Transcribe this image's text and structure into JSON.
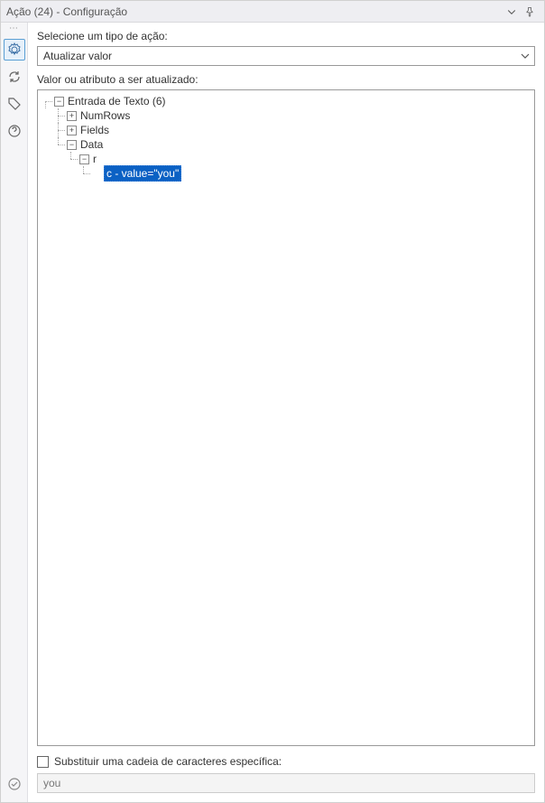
{
  "titlebar": {
    "title": "Ação (24) - Configuração"
  },
  "labels": {
    "actionType": "Selecione um tipo de ação:",
    "valueToUpdate": "Valor ou atributo a ser atualizado:",
    "replaceSpecific": "Substituir uma cadeia de caracteres específica:"
  },
  "select": {
    "value": "Atualizar valor"
  },
  "tree": {
    "root": "Entrada de Texto (6)",
    "numRows": "NumRows",
    "fields": "Fields",
    "data": "Data",
    "r": "r",
    "selected": "c - value=\"you\""
  },
  "replaceInput": {
    "value": "you"
  }
}
